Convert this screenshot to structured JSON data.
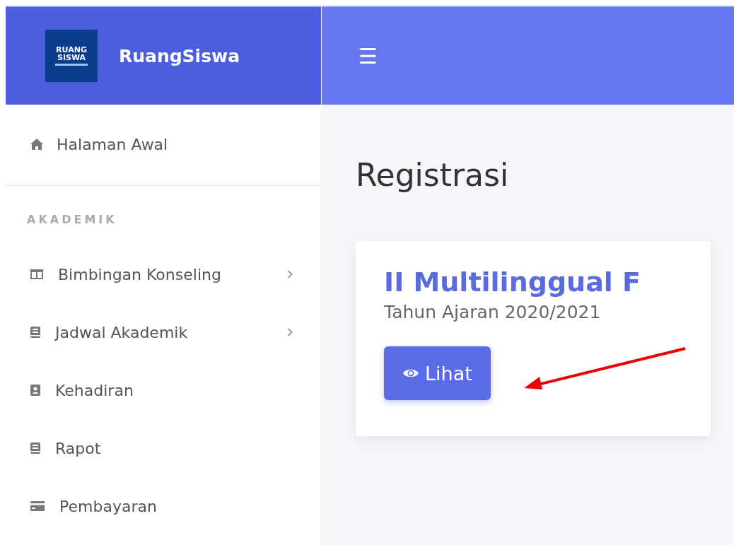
{
  "brand": {
    "logo_lines": [
      "RUANG",
      "SISWA"
    ],
    "name": "RuangSiswa"
  },
  "topbar": {
    "menu_glyph": "☰"
  },
  "sidebar": {
    "home": {
      "label": "Halaman Awal"
    },
    "section": "AKADEMIK",
    "items": [
      {
        "label": "Bimbingan Konseling",
        "kind": "submenu"
      },
      {
        "label": "Jadwal Akademik",
        "kind": "submenu"
      },
      {
        "label": "Kehadiran",
        "kind": "link"
      },
      {
        "label": "Rapot",
        "kind": "link"
      },
      {
        "label": "Pembayaran",
        "kind": "link"
      }
    ]
  },
  "page_title": "Registrasi",
  "card": {
    "title": "II Multilinggual F",
    "subtitle": "Tahun Ajaran 2020/2021",
    "button": "Lihat"
  }
}
